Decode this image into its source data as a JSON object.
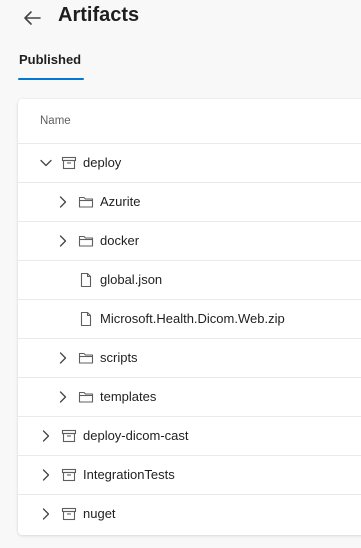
{
  "header": {
    "title": "Artifacts",
    "back_icon": "arrow-left-icon"
  },
  "tabs": [
    {
      "label": "Published",
      "selected": true
    }
  ],
  "table": {
    "column_header": "Name",
    "rows": [
      {
        "label": "deploy",
        "type": "artifact",
        "expander": "expanded",
        "level": 0
      },
      {
        "label": "Azurite",
        "type": "folder",
        "expander": "collapsed",
        "level": 1
      },
      {
        "label": "docker",
        "type": "folder",
        "expander": "collapsed",
        "level": 1
      },
      {
        "label": "global.json",
        "type": "file",
        "expander": "none",
        "level": 1
      },
      {
        "label": "Microsoft.Health.Dicom.Web.zip",
        "type": "file",
        "expander": "none",
        "level": 1
      },
      {
        "label": "scripts",
        "type": "folder",
        "expander": "collapsed",
        "level": 1
      },
      {
        "label": "templates",
        "type": "folder",
        "expander": "collapsed",
        "level": 1
      },
      {
        "label": "deploy-dicom-cast",
        "type": "artifact",
        "expander": "collapsed",
        "level": 0
      },
      {
        "label": "IntegrationTests",
        "type": "artifact",
        "expander": "collapsed",
        "level": 0
      },
      {
        "label": "nuget",
        "type": "artifact",
        "expander": "collapsed",
        "level": 0
      }
    ]
  },
  "colors": {
    "accent": "#0078d4",
    "text": "#201f1e",
    "icon": "#605e5c",
    "divider": "#eaeaea"
  }
}
